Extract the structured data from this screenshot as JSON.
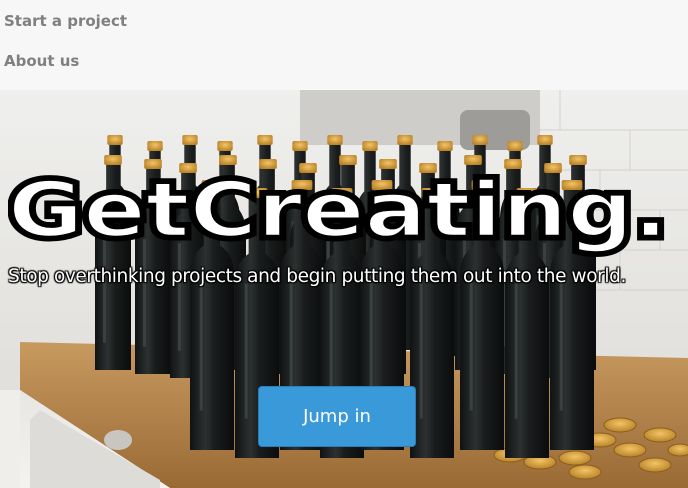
{
  "nav": {
    "items": [
      {
        "label": "Start a project"
      },
      {
        "label": "About us"
      }
    ]
  },
  "hero": {
    "headline": "GetCreating.",
    "tagline": "Stop overthinking projects and begin putting them out into the world.",
    "cta_label": "Jump in"
  },
  "colors": {
    "nav_background": "#f7f7f7",
    "nav_text": "#808080",
    "cta_background": "#3a9ad9",
    "cta_text": "#ffffff"
  }
}
